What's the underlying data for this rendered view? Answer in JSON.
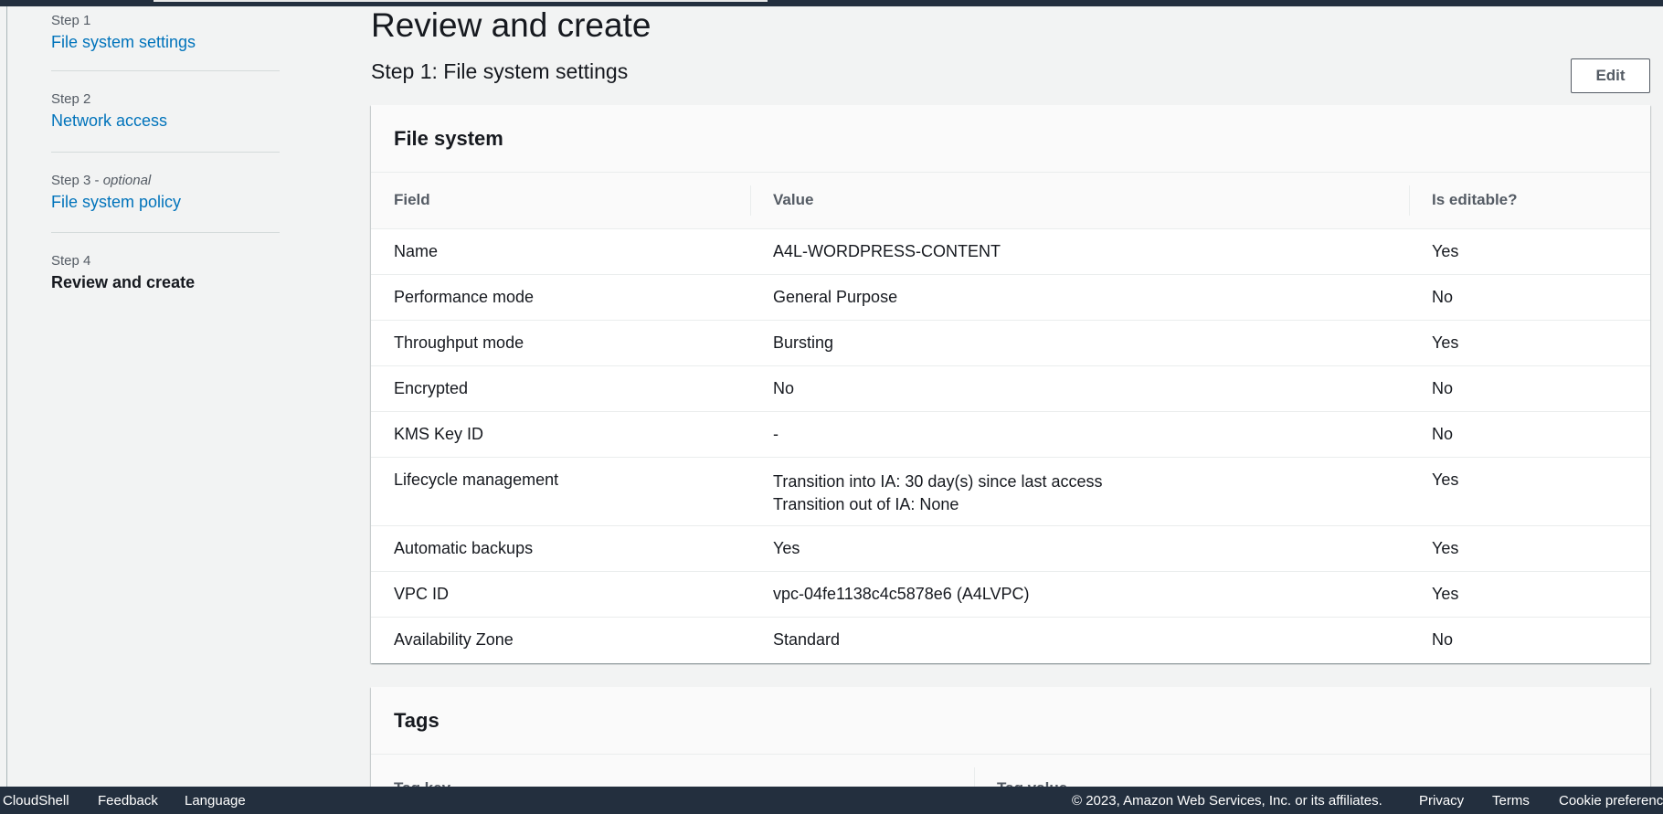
{
  "wizard": {
    "steps": [
      {
        "num": "Step 1",
        "title": "File system settings"
      },
      {
        "num": "Step 2",
        "title": "Network access"
      },
      {
        "num": "Step 3",
        "optional": "optional",
        "title": "File system policy"
      },
      {
        "num": "Step 4",
        "title": "Review and create"
      }
    ]
  },
  "page": {
    "title": "Review and create",
    "section_title": "Step 1: File system settings",
    "edit_label": "Edit"
  },
  "file_system": {
    "heading": "File system",
    "columns": [
      "Field",
      "Value",
      "Is editable?"
    ],
    "rows": [
      {
        "field": "Name",
        "value": "A4L-WORDPRESS-CONTENT",
        "editable": "Yes"
      },
      {
        "field": "Performance mode",
        "value": "General Purpose",
        "editable": "No"
      },
      {
        "field": "Throughput mode",
        "value": "Bursting",
        "editable": "Yes"
      },
      {
        "field": "Encrypted",
        "value": "No",
        "editable": "No"
      },
      {
        "field": "KMS Key ID",
        "value": "-",
        "editable": "No"
      },
      {
        "field": "Lifecycle management",
        "value": "Transition into IA: 30 day(s) since last access",
        "value2": "Transition out of IA: None",
        "editable": "Yes"
      },
      {
        "field": "Automatic backups",
        "value": "Yes",
        "editable": "Yes"
      },
      {
        "field": "VPC ID",
        "value": "vpc-04fe1138c4c5878e6 (A4LVPC)",
        "editable": "Yes"
      },
      {
        "field": "Availability Zone",
        "value": "Standard",
        "editable": "No"
      }
    ]
  },
  "tags": {
    "heading": "Tags",
    "columns": [
      "Tag key",
      "Tag value"
    ],
    "sort_icon_active": "▼",
    "sort_icon_inactive": "▽"
  },
  "footer": {
    "cloudshell": "CloudShell",
    "feedback": "Feedback",
    "language": "Language",
    "copyright": "© 2023, Amazon Web Services, Inc. or its affiliates.",
    "privacy": "Privacy",
    "terms": "Terms",
    "cookies": "Cookie preferences"
  }
}
